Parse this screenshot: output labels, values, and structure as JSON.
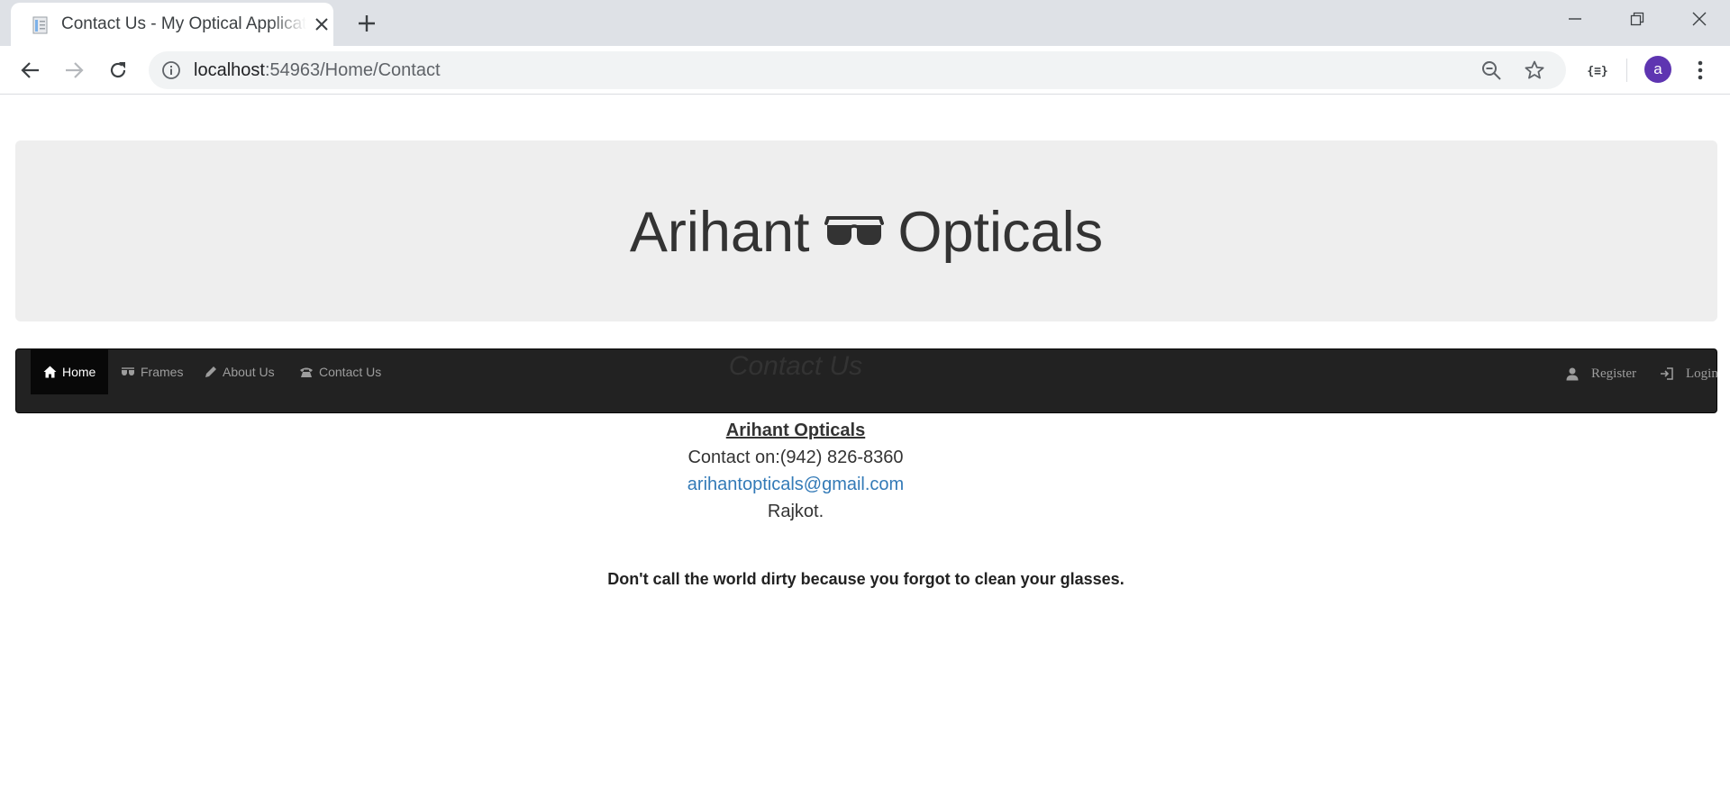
{
  "browser": {
    "tab_title": "Contact Us - My Optical Application",
    "url_host": "localhost",
    "url_rest": ":54963/Home/Contact",
    "extension_label": "{≡}",
    "profile_initial": "a"
  },
  "site": {
    "brand_left": "Arihant",
    "brand_right": "Opticals",
    "brand_icon": "sunglasses-icon"
  },
  "navbar": {
    "items": [
      {
        "label": "Home",
        "icon": "home-icon",
        "active": true
      },
      {
        "label": "Frames",
        "icon": "glasses-icon"
      },
      {
        "label": "About Us",
        "icon": "pencil-icon"
      },
      {
        "label": "Contact Us",
        "icon": "phone-icon"
      }
    ],
    "right": [
      {
        "label": "Register",
        "icon": "user-icon"
      },
      {
        "label": "Login",
        "icon": "login-icon"
      }
    ]
  },
  "contact": {
    "title": "Contact Us",
    "company": "Arihant Opticals",
    "phone": "Contact on:(942) 826-8360",
    "email": "arihantopticals@gmail.com",
    "city": "Rajkot."
  },
  "quote": "Don't call the world dirty because you forgot to clean your glasses.",
  "colors": {
    "navbar_bg": "#222222",
    "jumbotron_bg": "#eeeeee",
    "link": "#337ab7",
    "avatar": "#5e35b1"
  }
}
